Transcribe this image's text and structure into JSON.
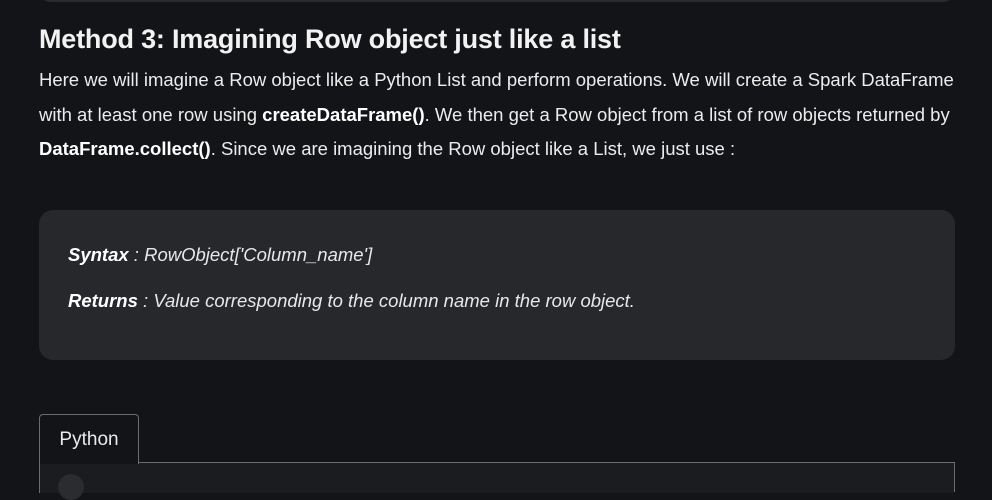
{
  "article": {
    "heading": "Method 3: Imagining Row object just like a list",
    "paragraph": {
      "t1": "Here we will imagine a Row object like a Python List and perform operations. We will create a Spark DataFrame with at least one row using ",
      "code1": "createDataFrame()",
      "t2": ". We then get a Row object from a list of row objects returned by ",
      "code2": "DataFrame.collect()",
      "t3": ". Since we are imagining the Row object like a List, we just use :"
    },
    "syntax_box": {
      "syntax_label": "Syntax",
      "syntax_value": " : RowObject['Column_name']",
      "returns_label": "Returns",
      "returns_value": " : Value corresponding to the column name in the row object."
    },
    "code_tabs": [
      {
        "label": "Python"
      }
    ]
  }
}
